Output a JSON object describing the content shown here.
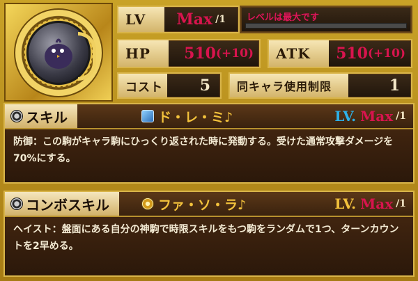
{
  "status": {
    "lv_label": "LV",
    "lv_value": "Max",
    "lv_suffix": "/1",
    "lv_message": "レベルは最大です",
    "hp_label": "HP",
    "hp_value": "510",
    "hp_bonus": "(+10)",
    "atk_label": "ATK",
    "atk_value": "510",
    "atk_bonus": "(+10)",
    "cost_label": "コスト",
    "cost_value": "5",
    "limit_label": "同キャラ使用制限",
    "limit_value": "1"
  },
  "skill": {
    "title": "スキル",
    "name": "ド・レ・ミ♪",
    "lv_prefix": "LV.",
    "lv_value": "Max",
    "lv_suffix": "/1",
    "description": "防御：この駒がキャラ駒にひっくり返された時に発動する。受けた通常攻撃ダメージを70%にする。"
  },
  "combo_skill": {
    "title": "コンボスキル",
    "name": "ファ・ソ・ラ♪",
    "lv_prefix": "LV.",
    "lv_value": "Max",
    "lv_suffix": "/1",
    "description": "ヘイスト：盤面にある自分の神駒で時限スキルをもつ駒をランダムで1つ、ターンカウントを2早める。"
  },
  "colors": {
    "gold_frame": "#d9b54a",
    "crimson": "#d8144e",
    "skill_gold": "#f3c23c",
    "panel_dark": "#2b180a"
  },
  "icons": {
    "portrait": "character-portrait-icon",
    "skill": "skill-icon",
    "combo": "combo-skill-icon",
    "skill_name": "shield-icon",
    "combo_name": "swirl-icon"
  }
}
